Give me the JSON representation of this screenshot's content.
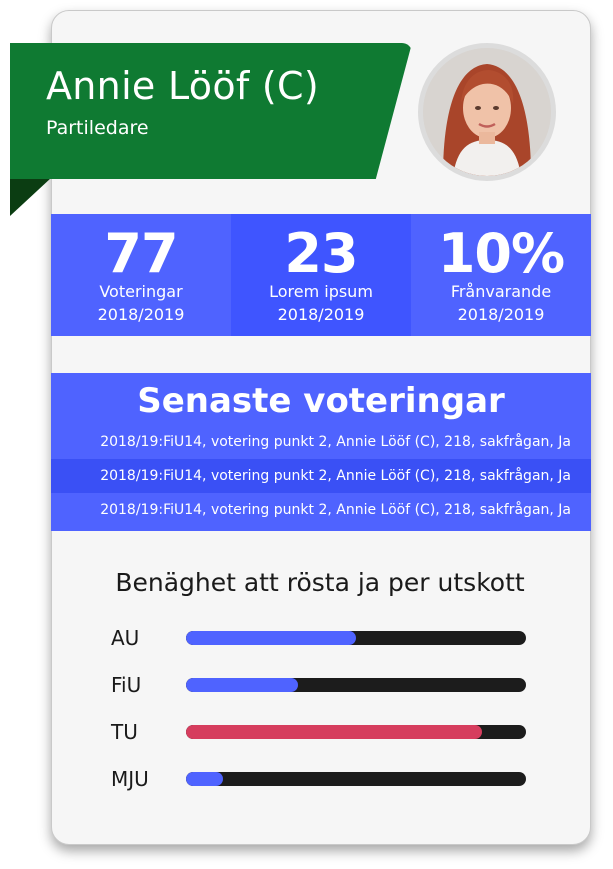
{
  "profile": {
    "name": "Annie Lööf (C)",
    "role": "Partiledare",
    "party_color": "#0f7a32"
  },
  "stats": [
    {
      "value": "77",
      "label": "Voteringar",
      "period": "2018/2019"
    },
    {
      "value": "23",
      "label": "Lorem ipsum",
      "period": "2018/2019"
    },
    {
      "value": "10%",
      "label": "Frånvarande",
      "period": "2018/2019"
    }
  ],
  "votes": {
    "title": "Senaste voteringar",
    "items": [
      "2018/19:FiU14, votering punkt 2, Annie Lööf (C), 218, sakfrågan, Ja",
      "2018/19:FiU14, votering punkt 2, Annie Lööf (C), 218, sakfrågan, Ja",
      "2018/19:FiU14, votering punkt 2, Annie Lööf (C), 218, sakfrågan, Ja"
    ]
  },
  "chart_data": {
    "type": "bar",
    "title": "Benäghet att rösta ja per utskott",
    "categories": [
      "AU",
      "FiU",
      "TU",
      "MJU"
    ],
    "values": [
      0.5,
      0.33,
      0.87,
      0.11
    ],
    "colors": [
      "#4f63ff",
      "#4f63ff",
      "#d63d5e",
      "#4f63ff"
    ],
    "track_color": "#1c1c1c",
    "ylim": [
      0,
      1
    ]
  }
}
